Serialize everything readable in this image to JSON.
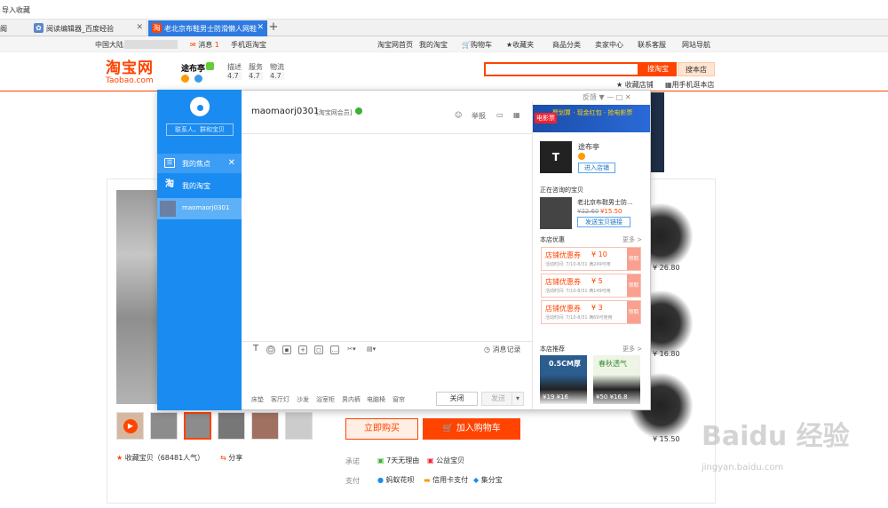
{
  "browser": {
    "favbar_text": "导入收藏",
    "tabs": [
      {
        "label": "阁"
      },
      {
        "label": "阅读编辑器_百度经验"
      },
      {
        "label": "老北京布鞋男士防滑懒人网鞋"
      }
    ],
    "new_tab": "+"
  },
  "sitenav": {
    "region": "中国大陆",
    "message": "消息",
    "message_count": "1",
    "mobile": "手机逛淘宝",
    "home": "淘宝网首页",
    "my_taobao": "我的淘宝",
    "cart": "购物车",
    "favorites": "收藏夹",
    "categories": "商品分类",
    "seller_center": "卖家中心",
    "support": "联系客服",
    "sitemap": "网站导航"
  },
  "header": {
    "logo_cn": "淘宝网",
    "logo_en": "Taobao.com",
    "shop_name": "途布亭",
    "ratings": [
      {
        "label": "描述",
        "score": "4.7"
      },
      {
        "label": "服务",
        "score": "4.7"
      },
      {
        "label": "物流",
        "score": "4.7"
      }
    ],
    "search_placeholder": "",
    "search_taobao": "搜淘宝",
    "search_store": "搜本店",
    "fav_store": "收藏店铺",
    "mobile_store": "用手机逛本店"
  },
  "product": {
    "buy_now": "立即购买",
    "add_cart": "加入购物车",
    "collect": "收藏宝贝（68481人气）",
    "share": "分享",
    "promise_label": "承诺",
    "promise_1": "7天无理由",
    "promise_2": "公益宝贝",
    "pay_label": "支付",
    "pay_1": "蚂蚁花呗",
    "pay_2": "信用卡支付",
    "pay_3": "集分宝",
    "rec_prices": [
      "¥ 26.80",
      "¥ 16.80",
      "¥ 15.50"
    ]
  },
  "chat": {
    "search_placeholder": "联系人、群和宝贝",
    "side_focus": "我的焦点",
    "side_taobao": "我的淘宝",
    "side_contact": "maomaorj0301",
    "user": "maomaorj0301",
    "member": "[淘宝网会员]",
    "report": "举报",
    "msg_history": "消息记录",
    "quick_words": [
      "床垫",
      "客厅灯",
      "沙发",
      "浴室柜",
      "男内裤",
      "电脑椅",
      "窗帘"
    ],
    "close": "关闭",
    "send": "发送",
    "window_controls": "反馈  ▼  —  □  ✕"
  },
  "panel": {
    "banner_tag": "电影票",
    "banner_text": "聚划算 · 现金红包 · 抢电影票",
    "shop_logo": "T",
    "shop_name": "途布亭",
    "enter_shop": "进入店铺",
    "asking_title": "正在咨询的宝贝",
    "asking_item": "老北京布鞋男士防...",
    "asking_old_price": "¥22.60",
    "asking_new_price": "¥15.50",
    "send_link": "发送宝贝链接",
    "coupons_title": "本店优惠",
    "more": "更多 >",
    "coupons": [
      {
        "name": "店铺优惠券",
        "value": "¥ 10",
        "time": "活动时间: 7/10-8/31 满249可用",
        "get": "领取"
      },
      {
        "name": "店铺优惠券",
        "value": "¥ 5",
        "time": "活动时间: 7/10-8/31 满149可用",
        "get": "领取"
      },
      {
        "name": "店铺优惠券",
        "value": "¥ 3",
        "time": "活动时间: 7/10-8/31 满69可使用",
        "get": "领取"
      }
    ],
    "rec_title": "本店推荐",
    "rec_items": [
      {
        "tag": "0.5CM厚",
        "price": "¥19  ¥16"
      },
      {
        "tag": "春秋透气",
        "price": "¥50  ¥16.8"
      }
    ]
  },
  "watermark": {
    "main": "Baidu 经验",
    "sub": "jingyan.baidu.com"
  },
  "colors": {
    "taobao_orange": "#ff4400",
    "wangwang_blue": "#1a8bf0"
  }
}
